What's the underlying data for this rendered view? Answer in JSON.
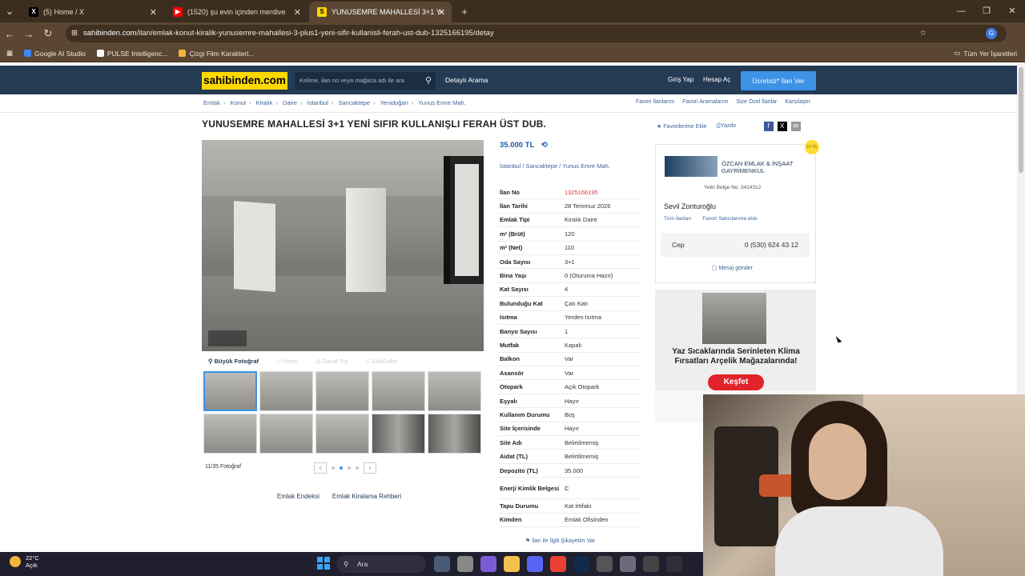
{
  "browser": {
    "tabs": [
      {
        "label": "(5) Home / X",
        "fav": "X",
        "favcolor": "#000000"
      },
      {
        "label": "(1520) şu evin içinden merdive",
        "fav": "▶",
        "favcolor": "#ff0000"
      },
      {
        "label": "YUNUSEMRE MAHALLESİ 3+1 Y",
        "fav": "S",
        "favcolor": "#ffd800"
      }
    ],
    "new_tab": "+",
    "url_host": "sahibinden.com",
    "url_path": "/ilan/emlak-konut-kiralik-yunusemre-mahallesi-3-plus1-yeni-sifir-kullanisli-ferah-ust-dub-1325166195/detay",
    "bookmarks": [
      "Google AI Studio",
      "PULSE Intelligenc...",
      "Çizgi Film Karakterl..."
    ],
    "bookmark_colors": [
      "#4285f4",
      "#ffffff",
      "#f4b33c"
    ],
    "all_bookmarks": "Tüm Yer İşaretleri"
  },
  "site": {
    "logo": "sahibinden.com",
    "search_placeholder": "Kelime, ilan no veya mağaza adı ile ara",
    "advanced_search": "Detaylı Arama",
    "login": "Giriş Yap",
    "signup": "Hesap Aç",
    "post_button": "Ücretsiz* İlan Ver",
    "brand_color": "#253b54",
    "accent_color": "#3e92e6"
  },
  "breadcrumbs": [
    "Emlak",
    "Konut",
    "Kiralık",
    "Daire",
    "İstanbul",
    "Sancaktepe",
    "Yenidoğan",
    "Yunus Emre Mah."
  ],
  "right_links": [
    "Favori İlanlarım",
    "Favori Aramalarım",
    "Size Özel İlanlar",
    "Karşılaştır"
  ],
  "listing": {
    "title": "YUNUSEMRE MAHALLESİ 3+1 YENİ SIFIR KULLANIŞLI FERAH ÜST DUB.",
    "add_favorite": "Favorilerime Ekle",
    "print": "Yazdır",
    "photo_tabs": [
      "Büyük Fotoğraf",
      "Video",
      "Sanal Tur",
      "SahiDeko"
    ],
    "photo_counter": "11/35 Fotoğraf",
    "price": "35.000 TL",
    "location": "İstanbul / Sancaktepe / Yunus Emre Mah.",
    "attributes": [
      {
        "k": "İlan No",
        "v": "1325166195",
        "red": true
      },
      {
        "k": "İlan Tarihi",
        "v": "28 Temmuz 2026"
      },
      {
        "k": "Emlak Tipi",
        "v": "Kiralık Daire"
      },
      {
        "k": "m² (Brüt)",
        "v": "120"
      },
      {
        "k": "m² (Net)",
        "v": "110"
      },
      {
        "k": "Oda Sayısı",
        "v": "3+1"
      },
      {
        "k": "Bina Yaşı",
        "v": "0 (Oturuma Hazır)"
      },
      {
        "k": "Kat Sayısı",
        "v": "4"
      },
      {
        "k": "Bulunduğu Kat",
        "v": "Çatı Katı"
      },
      {
        "k": "Isıtma",
        "v": "Yerden Isıtma"
      },
      {
        "k": "Banyo Sayısı",
        "v": "1"
      },
      {
        "k": "Mutfak",
        "v": "Kapalı"
      },
      {
        "k": "Balkon",
        "v": "Var"
      },
      {
        "k": "Asansör",
        "v": "Var"
      },
      {
        "k": "Otopark",
        "v": "Açık Otopark"
      },
      {
        "k": "Eşyalı",
        "v": "Hayır"
      },
      {
        "k": "Kullanım Durumu",
        "v": "Boş"
      },
      {
        "k": "Site İçerisinde",
        "v": "Hayır"
      },
      {
        "k": "Site Adı",
        "v": "Belirtilmemiş"
      },
      {
        "k": "Aidat (TL)",
        "v": "Belirtilmemiş"
      },
      {
        "k": "Depozito (TL)",
        "v": "35.000"
      },
      {
        "k": "Enerji Kimlik Belgesi",
        "v": "C",
        "tall": true
      },
      {
        "k": "Tapu Durumu",
        "v": "Kat İrtifakı"
      },
      {
        "k": "Kimden",
        "v": "Emlak Ofisinden"
      }
    ],
    "complaint": "İlan ile İlgili Şikayetim Var",
    "bottom_links": [
      "Emlak Endeksi",
      "Emlak Kiralama Rehberi"
    ]
  },
  "agent": {
    "office": "ÖZCAN EMLAK & İNŞAAT GAYRİMENKUL",
    "license": "Yetki Belge No:  3414312",
    "person": "Sevil Zonturoğlu",
    "all_listings": "Tüm İlanları",
    "add_fav_seller": "Favori Satıcılarıma ekle",
    "phone_label": "Cep",
    "phone": "0 (530) 624 43 12",
    "message": "Mesaj gönder",
    "badge": "10 YIL"
  },
  "ad": {
    "text": "Yaz Sıcaklarında Serinleten Klima Fırsatları Arçelik Mağazalarında!",
    "button": "Keşfet"
  },
  "taskbar": {
    "temp": "22°C",
    "weather": "Açık",
    "search": "Ara"
  }
}
